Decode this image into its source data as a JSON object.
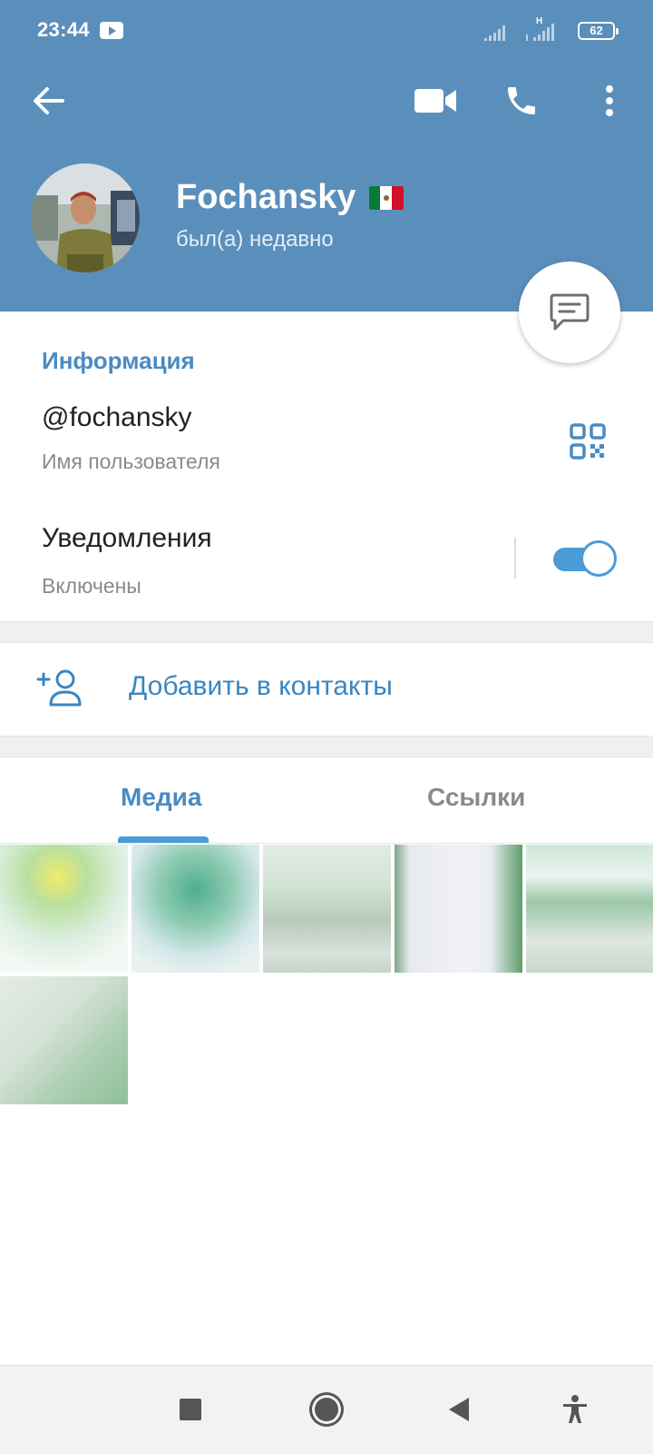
{
  "status_bar": {
    "time": "23:44",
    "battery": "62",
    "network_label": "H",
    "icons": [
      "youtube-icon",
      "signal-icon",
      "signal-h-icon",
      "battery-icon"
    ]
  },
  "header": {
    "background_color": "#5b8fbb",
    "icons": [
      "back-arrow-icon",
      "video-call-icon",
      "phone-icon",
      "more-vertical-icon"
    ],
    "name": "Fochansky",
    "flag": "mexico-flag",
    "status": "был(а) недавно",
    "fab_icon": "message-icon"
  },
  "info": {
    "section_title": "Информация",
    "username": "@fochansky",
    "username_caption": "Имя пользователя",
    "notifications_label": "Уведомления",
    "notifications_caption": "Включены",
    "notifications_enabled": true,
    "qr_icon": "qr-code-icon"
  },
  "actions": {
    "add_contact_label": "Добавить в контакты",
    "add_contact_icon": "add-person-icon"
  },
  "tabs": {
    "items": [
      {
        "label": "Медиа",
        "active": true
      },
      {
        "label": "Ссылки",
        "active": false
      }
    ],
    "active_color": "#4a8bc2",
    "inactive_color": "#8a8a8a"
  },
  "media": {
    "count": 6
  },
  "navbar": {
    "icons": [
      "recents-square-icon",
      "home-circle-icon",
      "back-triangle-icon",
      "accessibility-icon"
    ]
  }
}
